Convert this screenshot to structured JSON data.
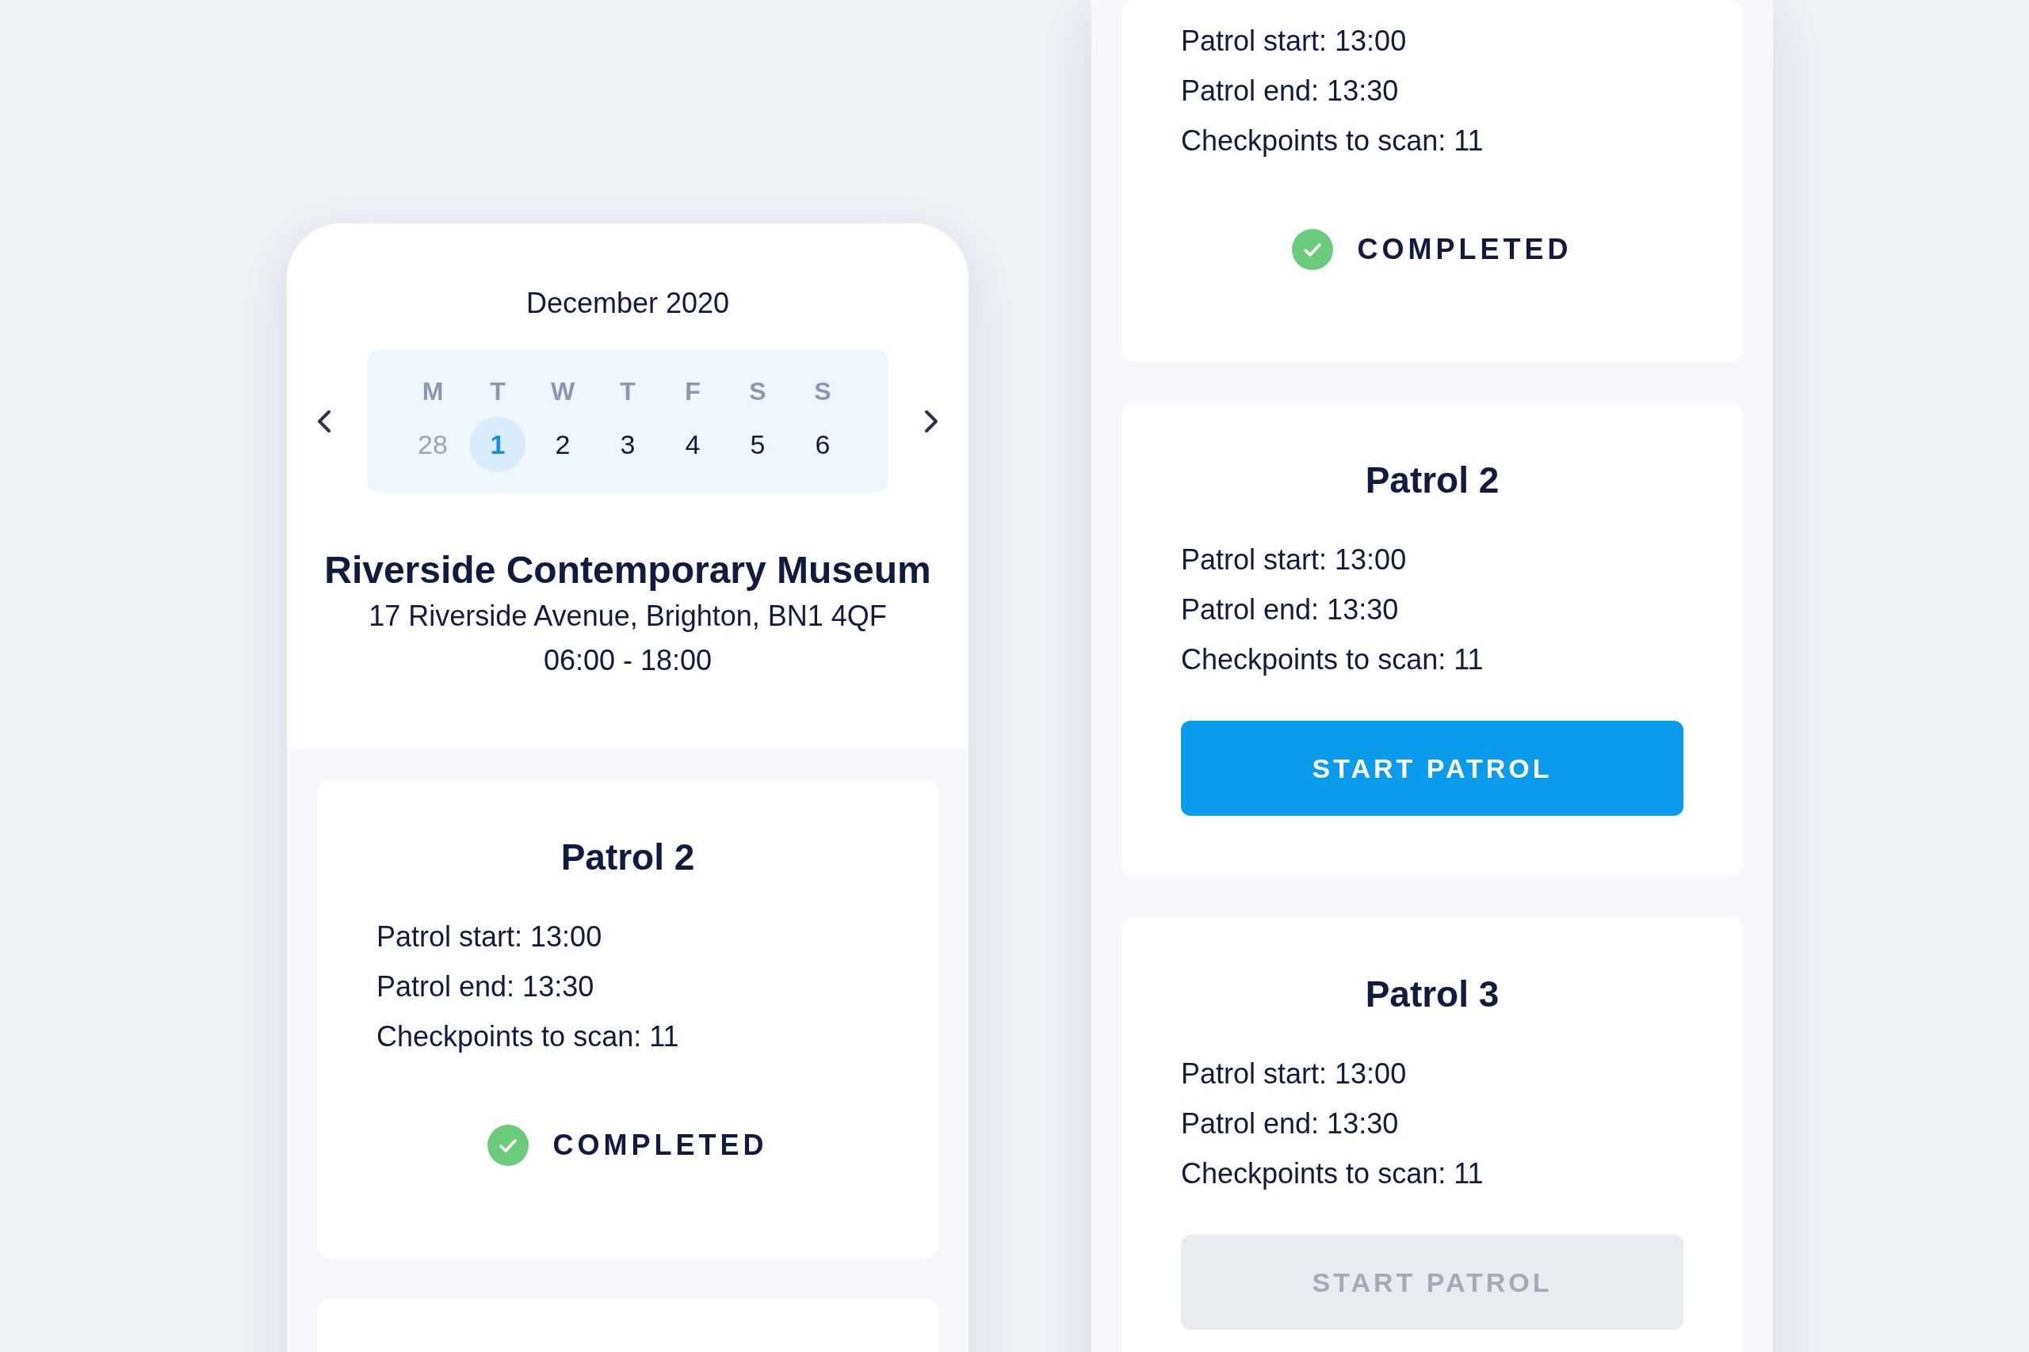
{
  "left_phone": {
    "calendar": {
      "month": "December 2020",
      "weekdays": [
        "M",
        "T",
        "W",
        "T",
        "F",
        "S",
        "S"
      ],
      "days": [
        {
          "label": "28",
          "selected": false,
          "muted": true
        },
        {
          "label": "1",
          "selected": true,
          "muted": false
        },
        {
          "label": "2",
          "selected": false,
          "muted": false
        },
        {
          "label": "3",
          "selected": false,
          "muted": false
        },
        {
          "label": "4",
          "selected": false,
          "muted": false
        },
        {
          "label": "5",
          "selected": false,
          "muted": false
        },
        {
          "label": "6",
          "selected": false,
          "muted": false
        }
      ]
    },
    "venue": {
      "name": "Riverside Contemporary Museum",
      "address": "17 Riverside Avenue, Brighton, BN1 4QF",
      "hours": "06:00 - 18:00"
    },
    "patrols": [
      {
        "title": "Patrol 2",
        "lines": [
          "Patrol start: 13:00",
          "Patrol end: 13:30",
          "Checkpoints to scan: 11"
        ],
        "status": {
          "kind": "completed",
          "label": "COMPLETED"
        }
      }
    ]
  },
  "right_phone": {
    "patrols": [
      {
        "lines": [
          "Patrol start: 13:00",
          "Patrol end: 13:30",
          "Checkpoints to scan: 11"
        ],
        "status": {
          "kind": "completed",
          "label": "COMPLETED"
        }
      },
      {
        "title": "Patrol 2",
        "lines": [
          "Patrol start: 13:00",
          "Patrol end: 13:30",
          "Checkpoints to scan: 11"
        ],
        "status": {
          "kind": "button",
          "label": "START PATROL",
          "disabled": false
        }
      },
      {
        "title": "Patrol 3",
        "lines": [
          "Patrol start: 13:00",
          "Patrol end: 13:30",
          "Checkpoints to scan: 11"
        ],
        "status": {
          "kind": "button",
          "label": "START PATROL",
          "disabled": true
        }
      }
    ]
  }
}
